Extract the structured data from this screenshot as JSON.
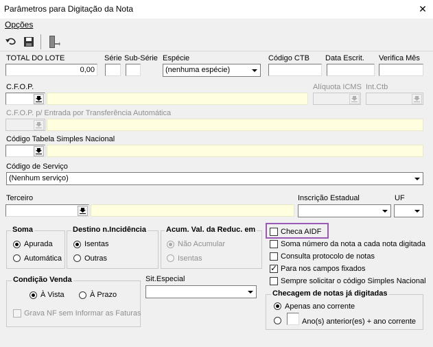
{
  "window": {
    "title": "Parâmetros para Digitação da Nota"
  },
  "menu": {
    "opcoes": "Opções"
  },
  "fields": {
    "total_lote": {
      "label": "TOTAL DO LOTE",
      "value": "0,00"
    },
    "serie": {
      "label": "Série"
    },
    "sub_serie": {
      "label": "Sub-Série"
    },
    "especie": {
      "label": "Espécie",
      "value": "(nenhuma espécie)"
    },
    "codigo_ctb": {
      "label": "Código CTB"
    },
    "data_escrit": {
      "label": "Data Escrit."
    },
    "verifica_mes": {
      "label": "Verifica Mês"
    },
    "cfop": {
      "label": "C.F.O.P."
    },
    "aliquota_icms": {
      "label": "Alíquota ICMS"
    },
    "int_ctb": {
      "label": "Int.Ctb"
    },
    "cfop_entrada": {
      "label": "C.F.O.P.  p/ Entrada por Transferência Automática"
    },
    "codigo_tabela": {
      "label": "Código Tabela Simples Nacional"
    },
    "codigo_servico": {
      "label": "Código de Serviço",
      "value": "(Nenhum serviço)"
    },
    "terceiro": {
      "label": "Terceiro"
    },
    "inscricao_estadual": {
      "label": "Inscrição Estadual"
    },
    "uf": {
      "label": "UF"
    },
    "sit_especial": {
      "label": "Sit.Especial"
    }
  },
  "groups": {
    "soma": {
      "title": "Soma",
      "options": [
        "Apurada",
        "Automática"
      ],
      "selected": "Apurada"
    },
    "destino": {
      "title": "Destino n.Incidência",
      "options": [
        "Isentas",
        "Outras"
      ],
      "selected": "Isentas"
    },
    "acum": {
      "title": "Acum. Val. da Reduc. em",
      "options": [
        "Não Acumular",
        "Isentas"
      ],
      "selected": "Não Acumular"
    },
    "condicao": {
      "title": "Condição Venda",
      "options": [
        "À Vista",
        "À Prazo"
      ],
      "selected": "À Vista",
      "grava_label": "Grava NF sem Informar as Faturas"
    },
    "checagem": {
      "title": "Checagem de notas já digitadas",
      "options": [
        "Apenas ano corrente",
        "Ano(s) anterior(es) + ano corrente"
      ],
      "selected": "Apenas ano corrente"
    }
  },
  "checks": [
    {
      "label": "Checa AIDF",
      "checked": false
    },
    {
      "label": "Soma número da nota a cada nota digitada",
      "checked": false
    },
    {
      "label": "Consulta protocolo de notas",
      "checked": false
    },
    {
      "label": "Para nos campos fixados",
      "checked": true
    },
    {
      "label": "Sempre solicitar o código Simples Nacional",
      "checked": false
    }
  ],
  "colors": {
    "highlight": "#9b59b6",
    "readonly_field": "#ffffe0"
  }
}
